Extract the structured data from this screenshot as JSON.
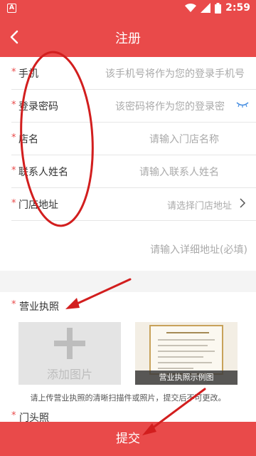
{
  "status_bar": {
    "app_icon_letter": "A",
    "time": "2:59"
  },
  "nav": {
    "title": "注册"
  },
  "form": {
    "phone": {
      "label": "手机",
      "hint": "该手机号将作为您的登录手机号"
    },
    "password": {
      "label": "登录密码",
      "hint": "该密码将作为您的登录密"
    },
    "store_name": {
      "label": "店名",
      "hint": "请输入门店名称"
    },
    "contact": {
      "label": "联系人姓名",
      "hint": "请输入联系人姓名"
    },
    "store_address": {
      "label": "门店地址",
      "hint": "请选择门店地址"
    },
    "detail_address": {
      "hint": "请输入详细地址(必填)"
    }
  },
  "license": {
    "title": "营业执照",
    "add_image_label": "添加图片",
    "sample_caption": "营业执照示例图",
    "tip": "请上传营业执照的清晰扫描件或照片，提交后不可更改。"
  },
  "storefront": {
    "title": "门头照"
  },
  "submit": {
    "label": "提交"
  },
  "required_mark": "*",
  "colors": {
    "primary": "#e94a4a",
    "annotation": "#d21e1e"
  }
}
